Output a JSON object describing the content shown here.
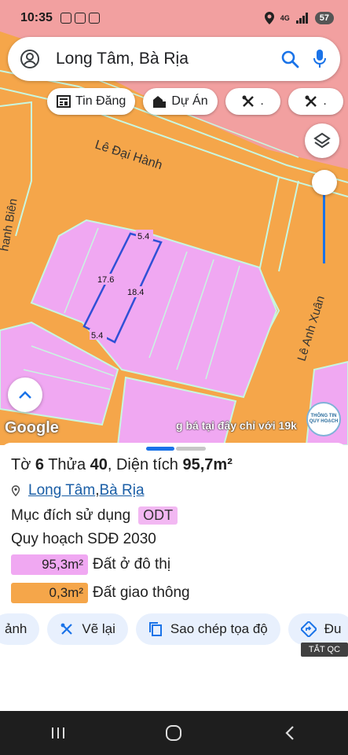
{
  "status_bar": {
    "time": "10:35",
    "network": "4G",
    "battery": "57"
  },
  "search": {
    "value": "Long Tâm, Bà Rịa"
  },
  "chips": [
    {
      "label": "Tin Đăng",
      "icon": "newspaper-icon"
    },
    {
      "label": "Dự Án",
      "icon": "buildings-icon"
    },
    {
      "label": ".",
      "icon": "tools-icon"
    },
    {
      "label": ".",
      "icon": "tools-icon"
    }
  ],
  "map": {
    "streets": [
      "Lê Đại Hành",
      "Lê Anh Xuân",
      "hanh Biên"
    ],
    "dimensions": [
      "5.4",
      "17.6",
      "18.4",
      "5.4"
    ],
    "google_logo": "Google",
    "promo_text": "g bá tại đây chỉ với 19k",
    "badge_text": "THÔNG TIN QUY HOẠCH",
    "colors": {
      "residential": "#f0a8f2",
      "traffic": "#f5a64a",
      "boundary": "#c8f7e0",
      "highlight": "#3050d6",
      "pink_zone": "#f2a0a0"
    }
  },
  "sheet": {
    "title_prefix_to": "Tờ ",
    "to_number": "6",
    "title_thua": " Thửa ",
    "thua_number": "40",
    "title_area_label": ", Diện tích ",
    "area": "95,7m²",
    "location_ward": "Long Tâm",
    "location_sep": ", ",
    "location_city": "Bà Rịa",
    "purpose_label": "Mục đích sử dụng",
    "purpose_code": "ODT",
    "plan_label": "Quy hoạch SDĐ 2030",
    "legend": [
      {
        "value": "95,3m²",
        "label": "Đất ở đô thị",
        "color": "#f0a8f2"
      },
      {
        "value": "0,3m²",
        "label": "Đất giao thông",
        "color": "#f5a64a"
      }
    ]
  },
  "actions": [
    {
      "label": "ảnh",
      "icon": ""
    },
    {
      "label": "Vẽ lại",
      "icon": "tools-icon"
    },
    {
      "label": "Sao chép tọa độ",
      "icon": "copy-icon"
    },
    {
      "label": "Đu",
      "icon": "directions-icon"
    }
  ],
  "tat_qc": "TẮT QC"
}
